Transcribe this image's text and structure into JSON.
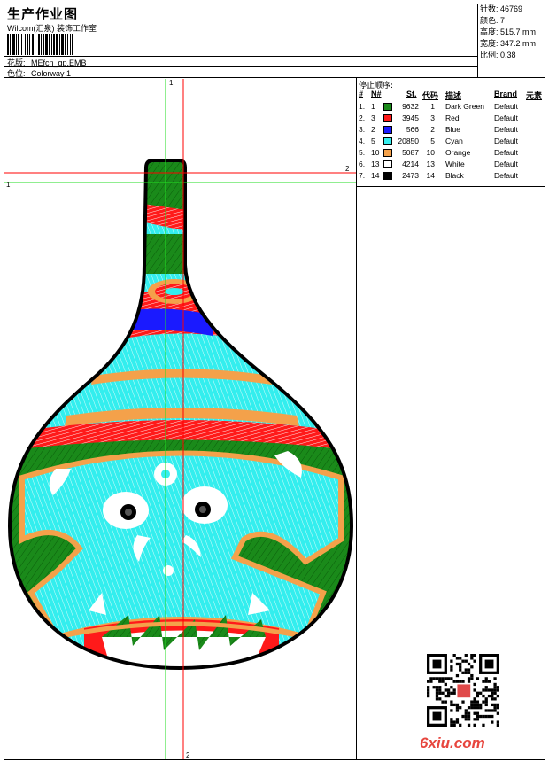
{
  "header": {
    "title": "生产作业图",
    "studio": "Wilcom(汇泉) 装饰工作室",
    "design_label": "花版:",
    "design_value": "MEfcn_gp.EMB",
    "colorway_label": "色位:",
    "colorway_value": "Colorway 1"
  },
  "stats": [
    {
      "label": "针数:",
      "value": "46769"
    },
    {
      "label": "颜色:",
      "value": "7"
    },
    {
      "label": "高度:",
      "value": "515.7 mm"
    },
    {
      "label": "宽度:",
      "value": "347.2 mm"
    },
    {
      "label": "比例:",
      "value": "0.38"
    }
  ],
  "stop_sequence": {
    "title": "停止顺序:",
    "headers": {
      "num": "#",
      "n": "N#",
      "st": "St.",
      "code": "代码",
      "desc": "描述",
      "brand": "Brand",
      "elem": "元素"
    },
    "rows": [
      {
        "idx": "1.",
        "n": "1",
        "color": "#1a8a1a",
        "st": "9632",
        "code": "1",
        "desc": "Dark Green",
        "brand": "Default"
      },
      {
        "idx": "2.",
        "n": "3",
        "color": "#ff1a1a",
        "st": "3945",
        "code": "3",
        "desc": "Red",
        "brand": "Default"
      },
      {
        "idx": "3.",
        "n": "2",
        "color": "#1a1aff",
        "st": "566",
        "code": "2",
        "desc": "Blue",
        "brand": "Default"
      },
      {
        "idx": "4.",
        "n": "5",
        "color": "#33eeee",
        "st": "20850",
        "code": "5",
        "desc": "Cyan",
        "brand": "Default"
      },
      {
        "idx": "5.",
        "n": "10",
        "color": "#f4a14a",
        "st": "5087",
        "code": "10",
        "desc": "Orange",
        "brand": "Default"
      },
      {
        "idx": "6.",
        "n": "13",
        "color": "#ffffff",
        "st": "4214",
        "code": "13",
        "desc": "White",
        "brand": "Default"
      },
      {
        "idx": "7.",
        "n": "14",
        "color": "#000000",
        "st": "2473",
        "code": "14",
        "desc": "Black",
        "brand": "Default"
      }
    ]
  },
  "guides": {
    "label_1": "1",
    "label_2": "2"
  },
  "watermark": {
    "text": "6xiu.com"
  }
}
